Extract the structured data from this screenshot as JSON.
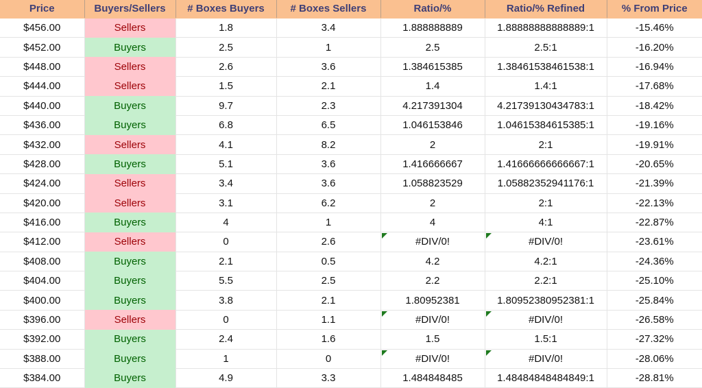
{
  "table": {
    "columns": [
      {
        "key": "price",
        "label": "Price"
      },
      {
        "key": "side",
        "label": "Buyers/Sellers"
      },
      {
        "key": "boxes_buyers",
        "label": "# Boxes Buyers"
      },
      {
        "key": "boxes_sellers",
        "label": "# Boxes Sellers"
      },
      {
        "key": "ratio",
        "label": "Ratio/%"
      },
      {
        "key": "ratio_refined",
        "label": "Ratio/% Refined"
      },
      {
        "key": "pct_from_price",
        "label": "% From Price"
      }
    ],
    "colors": {
      "header_fill": "#FAC090",
      "header_text": "#3F3F76",
      "sellers_fill": "#FFC7CE",
      "sellers_text": "#9C0006",
      "buyers_fill": "#C6EFCE",
      "buyers_text": "#006100",
      "error_flag": "#1F7A1F",
      "grid_line": "#E4E4E4"
    },
    "rows": [
      {
        "price": "$456.00",
        "side": "Sellers",
        "boxes_buyers": "1.8",
        "boxes_sellers": "3.4",
        "ratio": "1.888888889",
        "ratio_error": false,
        "ratio_refined": "1.88888888888889:1",
        "ratio_refined_error": false,
        "pct_from_price": "-15.46%"
      },
      {
        "price": "$452.00",
        "side": "Buyers",
        "boxes_buyers": "2.5",
        "boxes_sellers": "1",
        "ratio": "2.5",
        "ratio_error": false,
        "ratio_refined": "2.5:1",
        "ratio_refined_error": false,
        "pct_from_price": "-16.20%"
      },
      {
        "price": "$448.00",
        "side": "Sellers",
        "boxes_buyers": "2.6",
        "boxes_sellers": "3.6",
        "ratio": "1.384615385",
        "ratio_error": false,
        "ratio_refined": "1.38461538461538:1",
        "ratio_refined_error": false,
        "pct_from_price": "-16.94%"
      },
      {
        "price": "$444.00",
        "side": "Sellers",
        "boxes_buyers": "1.5",
        "boxes_sellers": "2.1",
        "ratio": "1.4",
        "ratio_error": false,
        "ratio_refined": "1.4:1",
        "ratio_refined_error": false,
        "pct_from_price": "-17.68%"
      },
      {
        "price": "$440.00",
        "side": "Buyers",
        "boxes_buyers": "9.7",
        "boxes_sellers": "2.3",
        "ratio": "4.217391304",
        "ratio_error": false,
        "ratio_refined": "4.21739130434783:1",
        "ratio_refined_error": false,
        "pct_from_price": "-18.42%"
      },
      {
        "price": "$436.00",
        "side": "Buyers",
        "boxes_buyers": "6.8",
        "boxes_sellers": "6.5",
        "ratio": "1.046153846",
        "ratio_error": false,
        "ratio_refined": "1.04615384615385:1",
        "ratio_refined_error": false,
        "pct_from_price": "-19.16%"
      },
      {
        "price": "$432.00",
        "side": "Sellers",
        "boxes_buyers": "4.1",
        "boxes_sellers": "8.2",
        "ratio": "2",
        "ratio_error": false,
        "ratio_refined": "2:1",
        "ratio_refined_error": false,
        "pct_from_price": "-19.91%"
      },
      {
        "price": "$428.00",
        "side": "Buyers",
        "boxes_buyers": "5.1",
        "boxes_sellers": "3.6",
        "ratio": "1.416666667",
        "ratio_error": false,
        "ratio_refined": "1.41666666666667:1",
        "ratio_refined_error": false,
        "pct_from_price": "-20.65%"
      },
      {
        "price": "$424.00",
        "side": "Sellers",
        "boxes_buyers": "3.4",
        "boxes_sellers": "3.6",
        "ratio": "1.058823529",
        "ratio_error": false,
        "ratio_refined": "1.05882352941176:1",
        "ratio_refined_error": false,
        "pct_from_price": "-21.39%"
      },
      {
        "price": "$420.00",
        "side": "Sellers",
        "boxes_buyers": "3.1",
        "boxes_sellers": "6.2",
        "ratio": "2",
        "ratio_error": false,
        "ratio_refined": "2:1",
        "ratio_refined_error": false,
        "pct_from_price": "-22.13%"
      },
      {
        "price": "$416.00",
        "side": "Buyers",
        "boxes_buyers": "4",
        "boxes_sellers": "1",
        "ratio": "4",
        "ratio_error": false,
        "ratio_refined": "4:1",
        "ratio_refined_error": false,
        "pct_from_price": "-22.87%"
      },
      {
        "price": "$412.00",
        "side": "Sellers",
        "boxes_buyers": "0",
        "boxes_sellers": "2.6",
        "ratio": "#DIV/0!",
        "ratio_error": true,
        "ratio_refined": "#DIV/0!",
        "ratio_refined_error": true,
        "pct_from_price": "-23.61%"
      },
      {
        "price": "$408.00",
        "side": "Buyers",
        "boxes_buyers": "2.1",
        "boxes_sellers": "0.5",
        "ratio": "4.2",
        "ratio_error": false,
        "ratio_refined": "4.2:1",
        "ratio_refined_error": false,
        "pct_from_price": "-24.36%"
      },
      {
        "price": "$404.00",
        "side": "Buyers",
        "boxes_buyers": "5.5",
        "boxes_sellers": "2.5",
        "ratio": "2.2",
        "ratio_error": false,
        "ratio_refined": "2.2:1",
        "ratio_refined_error": false,
        "pct_from_price": "-25.10%"
      },
      {
        "price": "$400.00",
        "side": "Buyers",
        "boxes_buyers": "3.8",
        "boxes_sellers": "2.1",
        "ratio": "1.80952381",
        "ratio_error": false,
        "ratio_refined": "1.80952380952381:1",
        "ratio_refined_error": false,
        "pct_from_price": "-25.84%"
      },
      {
        "price": "$396.00",
        "side": "Sellers",
        "boxes_buyers": "0",
        "boxes_sellers": "1.1",
        "ratio": "#DIV/0!",
        "ratio_error": true,
        "ratio_refined": "#DIV/0!",
        "ratio_refined_error": true,
        "pct_from_price": "-26.58%"
      },
      {
        "price": "$392.00",
        "side": "Buyers",
        "boxes_buyers": "2.4",
        "boxes_sellers": "1.6",
        "ratio": "1.5",
        "ratio_error": false,
        "ratio_refined": "1.5:1",
        "ratio_refined_error": false,
        "pct_from_price": "-27.32%"
      },
      {
        "price": "$388.00",
        "side": "Buyers",
        "boxes_buyers": "1",
        "boxes_sellers": "0",
        "ratio": "#DIV/0!",
        "ratio_error": true,
        "ratio_refined": "#DIV/0!",
        "ratio_refined_error": true,
        "pct_from_price": "-28.06%"
      },
      {
        "price": "$384.00",
        "side": "Buyers",
        "boxes_buyers": "4.9",
        "boxes_sellers": "3.3",
        "ratio": "1.484848485",
        "ratio_error": false,
        "ratio_refined": "1.48484848484849:1",
        "ratio_refined_error": false,
        "pct_from_price": "-28.81%"
      }
    ]
  }
}
